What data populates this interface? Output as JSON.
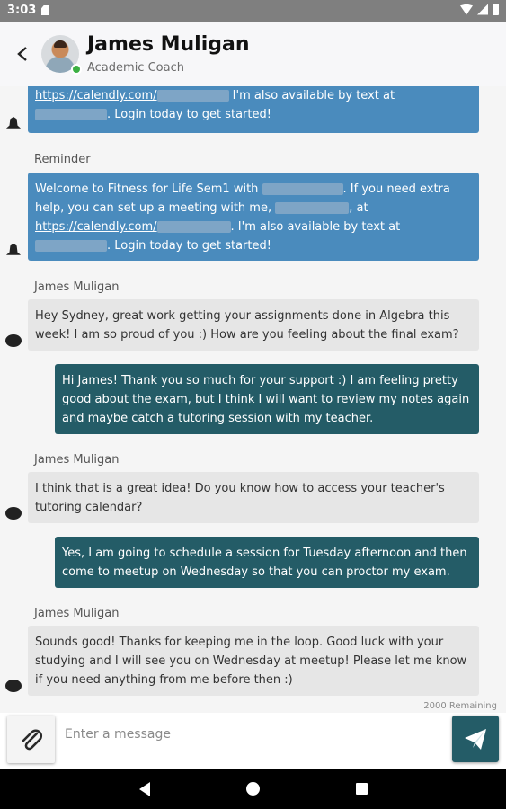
{
  "status_bar": {
    "time": "3:03"
  },
  "header": {
    "name": "James Muligan",
    "role": "Academic Coach"
  },
  "messages": [
    {
      "kind": "reminder",
      "line1_link": "https://calendly.com/",
      "line1_text": " I'm also available by text at",
      "line2_text": ". Login today to get started!"
    },
    {
      "kind": "reminder",
      "sender": "Reminder",
      "line1_pre": "Welcome to Fitness for Life Sem1 with ",
      "line1_post": ". If you need extra",
      "line2_pre": "help, you can set up a meeting with me, ",
      "line2_post": ", at",
      "line3_link": "https://calendly.com/",
      "line3_post": ". I'm also available by text at",
      "line4_post": ". Login today to get started!"
    },
    {
      "kind": "incoming",
      "sender": "James Muligan",
      "text": "Hey Sydney, great work getting your assignments done in Algebra this week! I am so proud of you :) How are you feeling about the final exam?"
    },
    {
      "kind": "outgoing",
      "text": "Hi James! Thank you so much for your support :) I am feeling pretty good about the exam, but I think I will want to review my notes again and maybe catch a tutoring session with my teacher."
    },
    {
      "kind": "incoming",
      "sender": "James Muligan",
      "text": "I think that is a great idea! Do you know how to access your teacher's tutoring calendar?"
    },
    {
      "kind": "outgoing",
      "text": "Yes, I am going to schedule a session for Tuesday afternoon and then come to meetup on Wednesday so that you can proctor my exam."
    },
    {
      "kind": "incoming",
      "sender": "James Muligan",
      "text": "Sounds good! Thanks for keeping me in the loop. Good luck with your studying and I will see you on Wednesday at meetup! Please let me know if you need anything from me before then :)"
    }
  ],
  "composer": {
    "remaining": "2000 Remaining",
    "placeholder": "Enter a message"
  },
  "icons": {
    "back": "chevron-left-icon",
    "attach": "paperclip-icon",
    "send": "send-icon",
    "reminder": "bell-icon",
    "message": "chat-bubble-icon"
  },
  "colors": {
    "reminder_bubble": "#4a8bbd",
    "incoming_bubble": "#e6e6e6",
    "outgoing_bubble": "#245c67",
    "send_button": "#245c67",
    "online": "#3cb043"
  }
}
